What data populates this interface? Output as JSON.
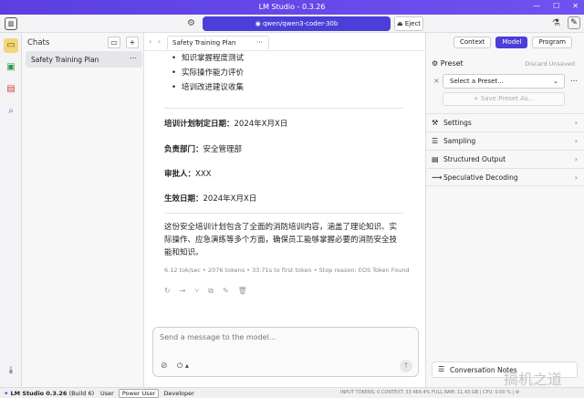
{
  "window": {
    "title": "LM Studio - 0.3.26",
    "controls": [
      "—",
      "☐",
      "✕"
    ]
  },
  "toolbar": {
    "model_label": "qwen/qwen3-coder-30b",
    "eject_label": "Eject"
  },
  "chats": {
    "header": "Chats",
    "items": [
      {
        "label": "Safety Training Plan"
      }
    ]
  },
  "tab": {
    "label": "Safety Training Plan"
  },
  "content": {
    "bullets": [
      "知识掌握程度测试",
      "实际操作能力评价",
      "培训改进建议收集"
    ],
    "fields": [
      {
        "key": "培训计划制定日期：",
        "value": "2024年X月X日"
      },
      {
        "key": "负责部门：",
        "value": "安全管理部"
      },
      {
        "key": "审批人：",
        "value": "XXX"
      },
      {
        "key": "生效日期：",
        "value": "2024年X月X日"
      }
    ],
    "summary": "这份安全培训计划包含了全面的消防培训内容，涵盖了理论知识、实际操作、应急演练等多个方面，确保员工能够掌握必要的消防安全技能和知识。",
    "stats": "6.12 tok/sec • 2076 tokens • 33.71s to first token • Stop reason: EOS Token Found"
  },
  "composer": {
    "placeholder": "Send a message to the model..."
  },
  "right_panel": {
    "tabs": [
      "Context",
      "Model",
      "Program"
    ],
    "active_tab": "Model",
    "preset_label": "Preset",
    "discard_label": "Discard Unsaved",
    "preset_select": "Select a Preset...",
    "save_preset": "+ Save Preset As...",
    "sections": [
      "Settings",
      "Sampling",
      "Structured Output",
      "Speculative Decoding"
    ],
    "notes": "Conversation Notes"
  },
  "statusbar": {
    "brand": "LM Studio 0.3.26",
    "build": "(Build 6)",
    "modes": [
      "User",
      "Power User",
      "Developer"
    ],
    "active_mode": "Power User",
    "sys": "INPUT TOKENS: 0     CONTEXT: 33 464.4% FULL          RAM: 11.43 GB  |  CPU: 0.00 %  |  ⚙"
  },
  "watermark": "搞机之道",
  "colors": {
    "accent": "#4a3fd8",
    "titlebar": "#5b3fe0"
  }
}
